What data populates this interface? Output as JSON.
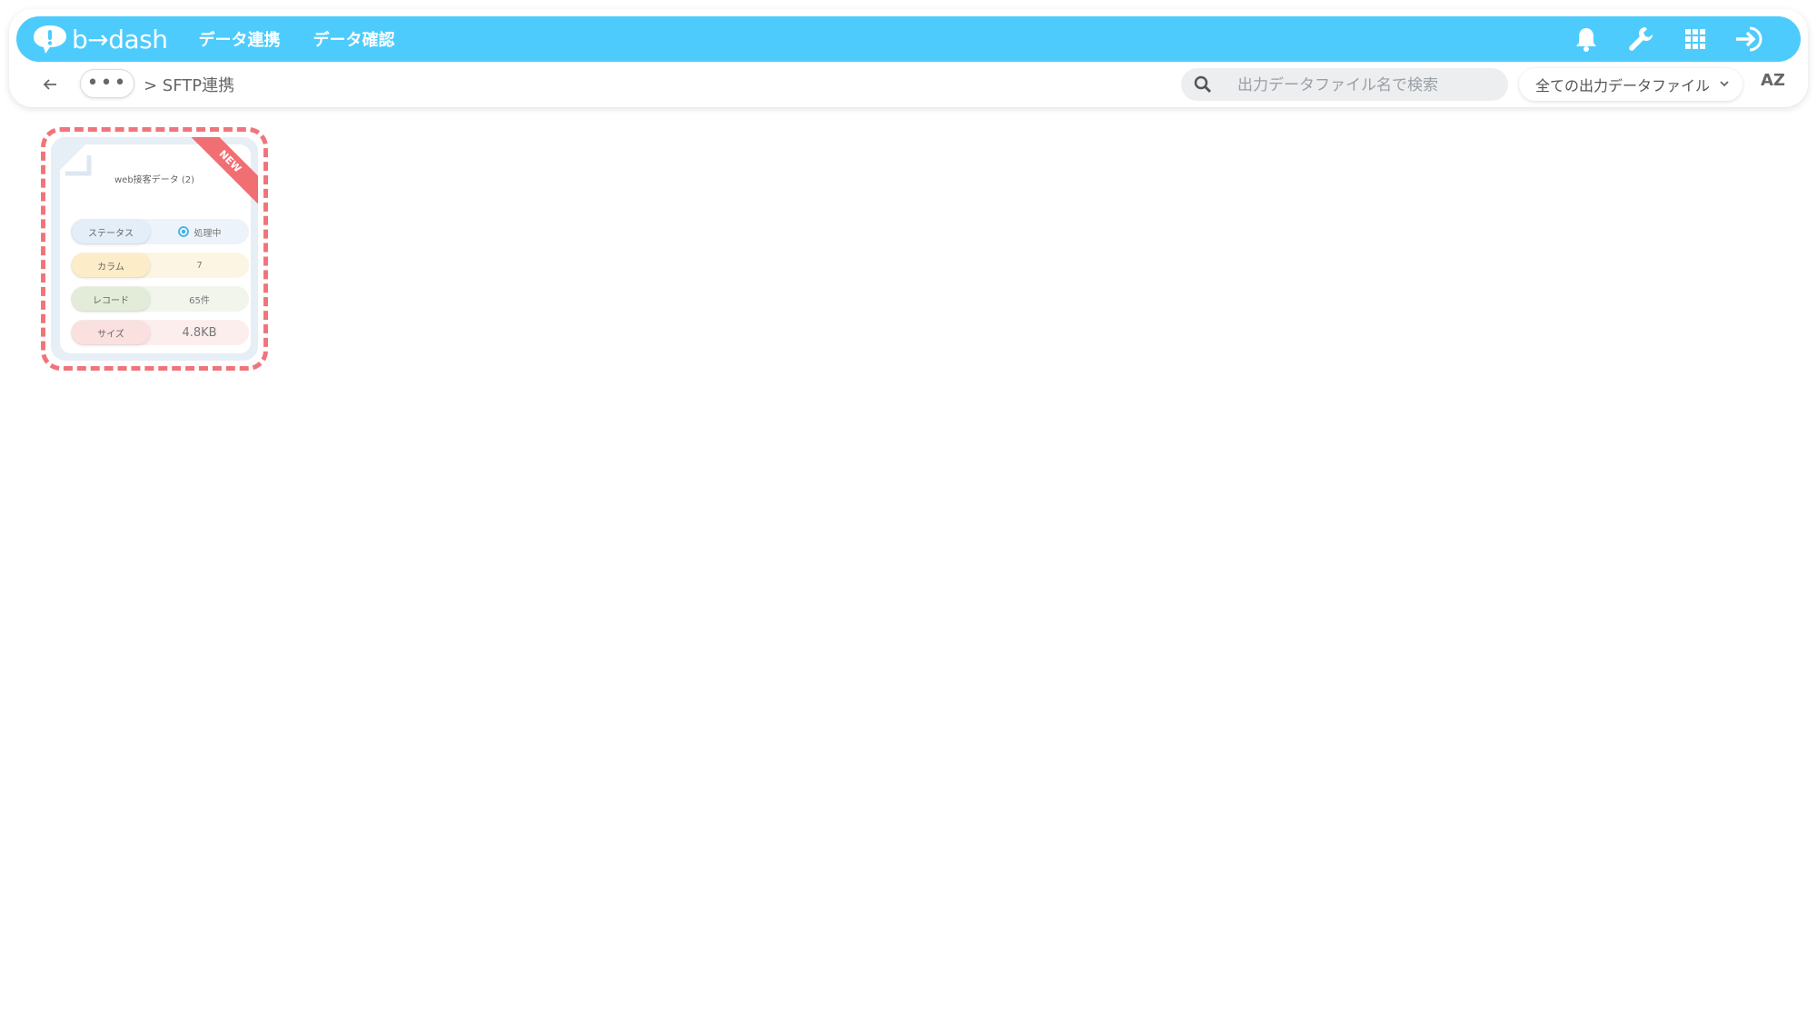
{
  "app": {
    "logo_text": "b→dash",
    "nav": [
      "データ連携",
      "データ確認"
    ]
  },
  "topbar": {
    "icons": [
      "bell-icon",
      "wrench-icon",
      "apps-grid-icon",
      "sign-in-icon"
    ]
  },
  "subbar": {
    "more_label": "•••",
    "breadcrumb": "> SFTP連携",
    "search_placeholder": "出力データファイル名で検索",
    "filter_label": "全ての出力データファイル",
    "sort_label": "AZ"
  },
  "colors": {
    "header": "#4dcbfd",
    "highlight_dash": "#f0757b",
    "new_ribbon": "#f16e72"
  },
  "card": {
    "badge": "NEW",
    "title": "web接客データ (2)",
    "rows": [
      {
        "key": "ステータス",
        "value": "処理中"
      },
      {
        "key": "カラム",
        "value": "7"
      },
      {
        "key": "レコード",
        "value": "65件"
      },
      {
        "key": "サイズ",
        "value": "4.8KB"
      }
    ]
  }
}
